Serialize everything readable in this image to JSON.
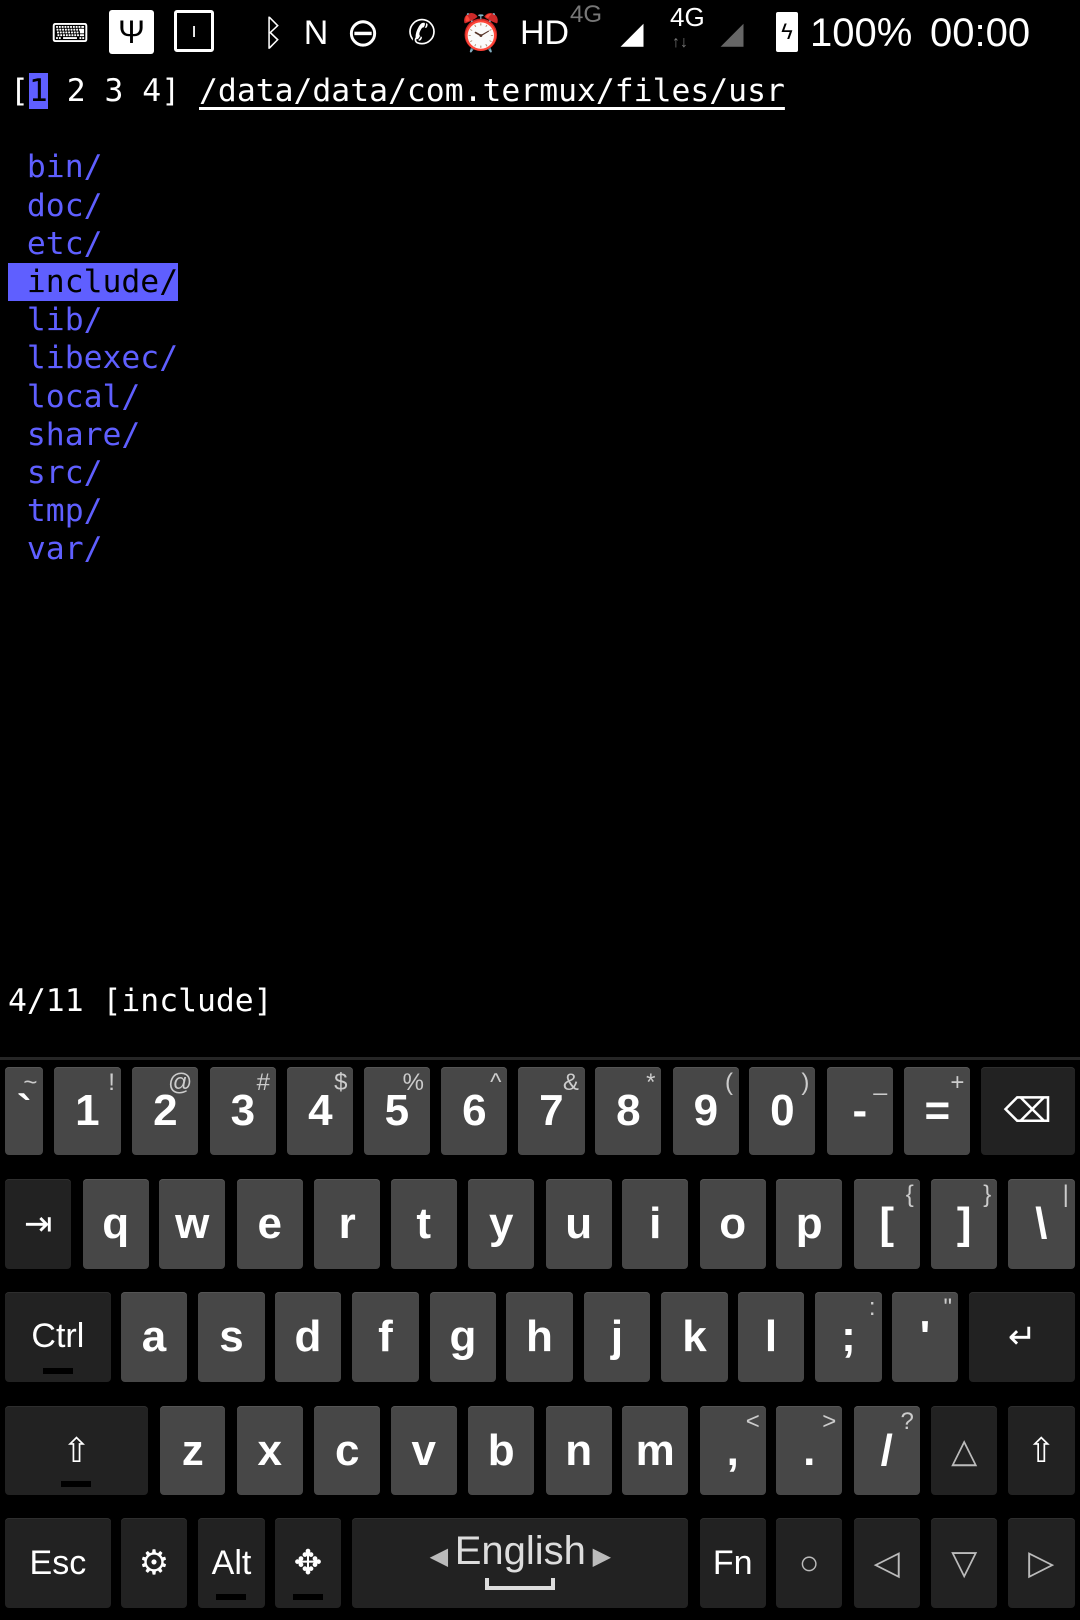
{
  "status_bar": {
    "icons": [
      "keyboard-icon",
      "usb-icon",
      "sd-card-icon",
      "bluetooth-icon",
      "nfc-icon",
      "do-not-disturb-icon",
      "missed-call-off-icon",
      "alarm-icon"
    ],
    "hd": "HD",
    "net1": "4G",
    "net2": "4G",
    "battery": "100%",
    "time": "00:00"
  },
  "terminal": {
    "tabs_open": "[",
    "tab_current": "1",
    "tabs_rest": " 2 3 4]",
    "path": "/data/data/com.termux/files/usr",
    "entries": [
      "bin/",
      "doc/",
      "etc/",
      "include/",
      "lib/",
      "libexec/",
      "local/",
      "share/",
      "src/",
      "tmp/",
      "var/"
    ],
    "selected_index": 3,
    "status": "4/11 [include]",
    "colors": {
      "directory": "#5f5fff",
      "highlight": "#5f5fff"
    }
  },
  "keyboard": {
    "language": "English",
    "rows": [
      [
        {
          "l": "`",
          "h": "~"
        },
        {
          "l": "1",
          "h": "!"
        },
        {
          "l": "2",
          "h": "@"
        },
        {
          "l": "3",
          "h": "#"
        },
        {
          "l": "4",
          "h": "$"
        },
        {
          "l": "5",
          "h": "%"
        },
        {
          "l": "6",
          "h": "^"
        },
        {
          "l": "7",
          "h": "&"
        },
        {
          "l": "8",
          "h": "*"
        },
        {
          "l": "9",
          "h": "("
        },
        {
          "l": "0",
          "h": ")"
        },
        {
          "l": "-",
          "h": "_"
        },
        {
          "l": "=",
          "h": "+"
        },
        {
          "l": "⌫",
          "h": "",
          "icon": "backspace-icon",
          "fn": true
        }
      ],
      [
        {
          "l": "⇥",
          "h": "",
          "icon": "tab-icon",
          "fn": true
        },
        {
          "l": "q",
          "h": ""
        },
        {
          "l": "w",
          "h": ""
        },
        {
          "l": "e",
          "h": ""
        },
        {
          "l": "r",
          "h": ""
        },
        {
          "l": "t",
          "h": ""
        },
        {
          "l": "y",
          "h": ""
        },
        {
          "l": "u",
          "h": ""
        },
        {
          "l": "i",
          "h": ""
        },
        {
          "l": "o",
          "h": ""
        },
        {
          "l": "p",
          "h": ""
        },
        {
          "l": "[",
          "h": "{"
        },
        {
          "l": "]",
          "h": "}"
        },
        {
          "l": "\\",
          "h": "|"
        }
      ],
      [
        {
          "l": "Ctrl",
          "h": "",
          "fn": true,
          "ind": true
        },
        {
          "l": "a",
          "h": ""
        },
        {
          "l": "s",
          "h": ""
        },
        {
          "l": "d",
          "h": ""
        },
        {
          "l": "f",
          "h": ""
        },
        {
          "l": "g",
          "h": ""
        },
        {
          "l": "h",
          "h": ""
        },
        {
          "l": "j",
          "h": ""
        },
        {
          "l": "k",
          "h": ""
        },
        {
          "l": "l",
          "h": ""
        },
        {
          "l": ";",
          "h": ":"
        },
        {
          "l": "'",
          "h": "\""
        },
        {
          "l": "↵",
          "h": "",
          "icon": "enter-icon",
          "fn": true
        }
      ],
      [
        {
          "l": "⇧",
          "h": "",
          "icon": "shift-icon",
          "fn": true,
          "ind": true
        },
        {
          "l": "z",
          "h": ""
        },
        {
          "l": "x",
          "h": ""
        },
        {
          "l": "c",
          "h": ""
        },
        {
          "l": "v",
          "h": ""
        },
        {
          "l": "b",
          "h": ""
        },
        {
          "l": "n",
          "h": ""
        },
        {
          "l": "m",
          "h": ""
        },
        {
          "l": ",",
          "h": "<"
        },
        {
          "l": ".",
          "h": ">"
        },
        {
          "l": "/",
          "h": "?"
        },
        {
          "l": "△",
          "h": "",
          "icon": "arrow-up-icon",
          "fn": true
        },
        {
          "l": "⇧",
          "h": "",
          "icon": "shift-icon",
          "fn": true
        }
      ],
      [
        {
          "l": "Esc",
          "h": "",
          "fn": true
        },
        {
          "l": "⚙",
          "h": "",
          "icon": "settings-icon",
          "fn": true
        },
        {
          "l": "Alt",
          "h": "",
          "fn": true,
          "ind": true
        },
        {
          "l": "✥",
          "h": "",
          "icon": "dpad-icon",
          "fn": true,
          "ind": true
        },
        {
          "l": "◂ English ▸",
          "h": "",
          "icon": "space-icon",
          "fn": true
        },
        {
          "l": "Fn",
          "h": "",
          "fn": true
        },
        {
          "l": "○",
          "h": "",
          "icon": "home-icon",
          "fn": true
        },
        {
          "l": "◁",
          "h": "",
          "icon": "arrow-left-icon",
          "fn": true
        },
        {
          "l": "▽",
          "h": "",
          "icon": "arrow-down-icon",
          "fn": true
        },
        {
          "l": "▷",
          "h": "",
          "icon": "arrow-right-icon",
          "fn": true
        }
      ]
    ]
  }
}
